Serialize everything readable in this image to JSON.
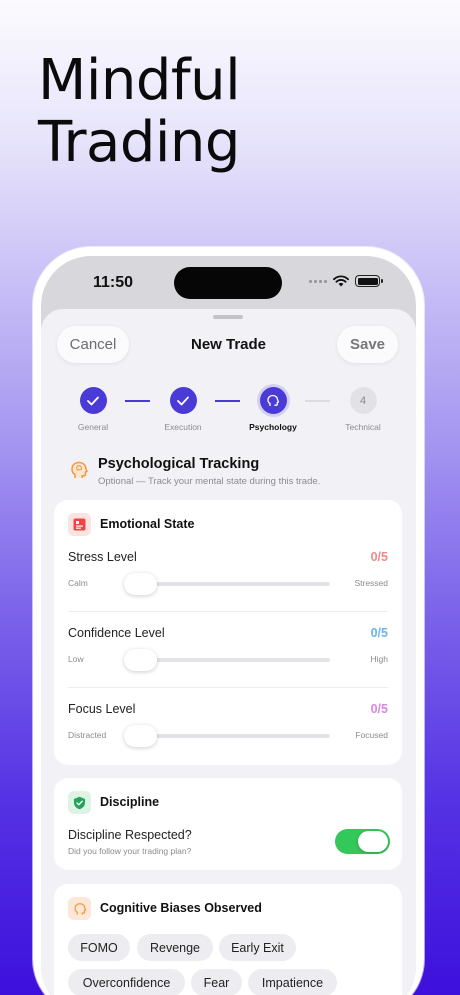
{
  "hero": {
    "line1": "Mindful",
    "line2": "Trading"
  },
  "status_bar": {
    "time": "11:50"
  },
  "nav": {
    "cancel": "Cancel",
    "title": "New Trade",
    "save": "Save"
  },
  "steps": [
    {
      "label": "General",
      "state": "done"
    },
    {
      "label": "Execution",
      "state": "done"
    },
    {
      "label": "Psychology",
      "state": "current"
    },
    {
      "label": "Technical",
      "state": "pending",
      "number": "4"
    }
  ],
  "section": {
    "title": "Psychological Tracking",
    "subtitle": "Optional — Track your mental state during this trade."
  },
  "emotional": {
    "title": "Emotional State",
    "sliders": [
      {
        "name": "Stress Level",
        "value": "0/5",
        "min_label": "Calm",
        "max_label": "Stressed",
        "level": 0,
        "color": "#f08a8a"
      },
      {
        "name": "Confidence Level",
        "value": "0/5",
        "min_label": "Low",
        "max_label": "High",
        "level": 0,
        "color": "#6cb3ec"
      },
      {
        "name": "Focus Level",
        "value": "0/5",
        "min_label": "Distracted",
        "max_label": "Focused",
        "level": 0,
        "color": "#d987e0"
      }
    ]
  },
  "discipline": {
    "title": "Discipline",
    "question": "Discipline Respected?",
    "hint": "Did you follow your trading plan?",
    "enabled": true
  },
  "biases": {
    "title": "Cognitive Biases Observed",
    "chips": [
      "FOMO",
      "Revenge",
      "Early Exit",
      "Overconfidence",
      "Fear",
      "Impatience"
    ]
  },
  "colors": {
    "accent": "#4a3ad6",
    "toggle_on": "#34c759",
    "emotional_icon_bg": "#fde2e2",
    "discipline_icon_bg": "#dff3e4",
    "biases_icon_bg": "#fde7d9"
  }
}
